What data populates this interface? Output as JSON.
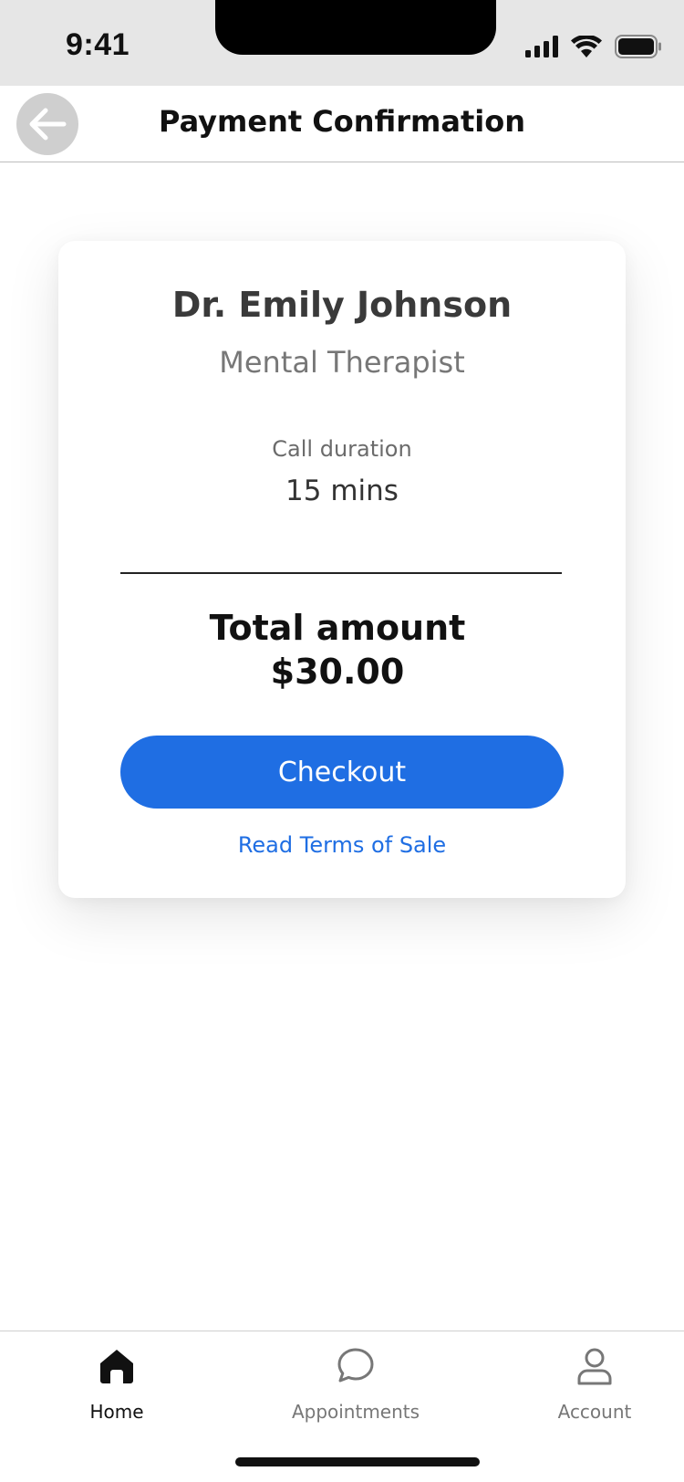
{
  "status_bar": {
    "time": "9:41",
    "icons": [
      "signal-icon",
      "wifi-icon",
      "battery-icon"
    ]
  },
  "header": {
    "title": "Payment Confirmation",
    "back_icon": "arrow-left-icon"
  },
  "card": {
    "doctor_name": "Dr. Emily Johnson",
    "doctor_role": "Mental Therapist",
    "duration_label": "Call duration",
    "duration_value": "15 mins",
    "total_label": "Total amount",
    "total_value": "$30.00",
    "checkout_label": "Checkout",
    "terms_link": "Read Terms of Sale"
  },
  "tabs": [
    {
      "label": "Home",
      "icon": "home-icon",
      "active": true
    },
    {
      "label": "Appointments",
      "icon": "chat-bubble-icon",
      "active": false
    },
    {
      "label": "Account",
      "icon": "user-icon",
      "active": false
    }
  ],
  "colors": {
    "accent": "#1f6ee3",
    "status_bar_bg": "#e6e6e6",
    "back_button_bg": "#cfcfcf"
  }
}
